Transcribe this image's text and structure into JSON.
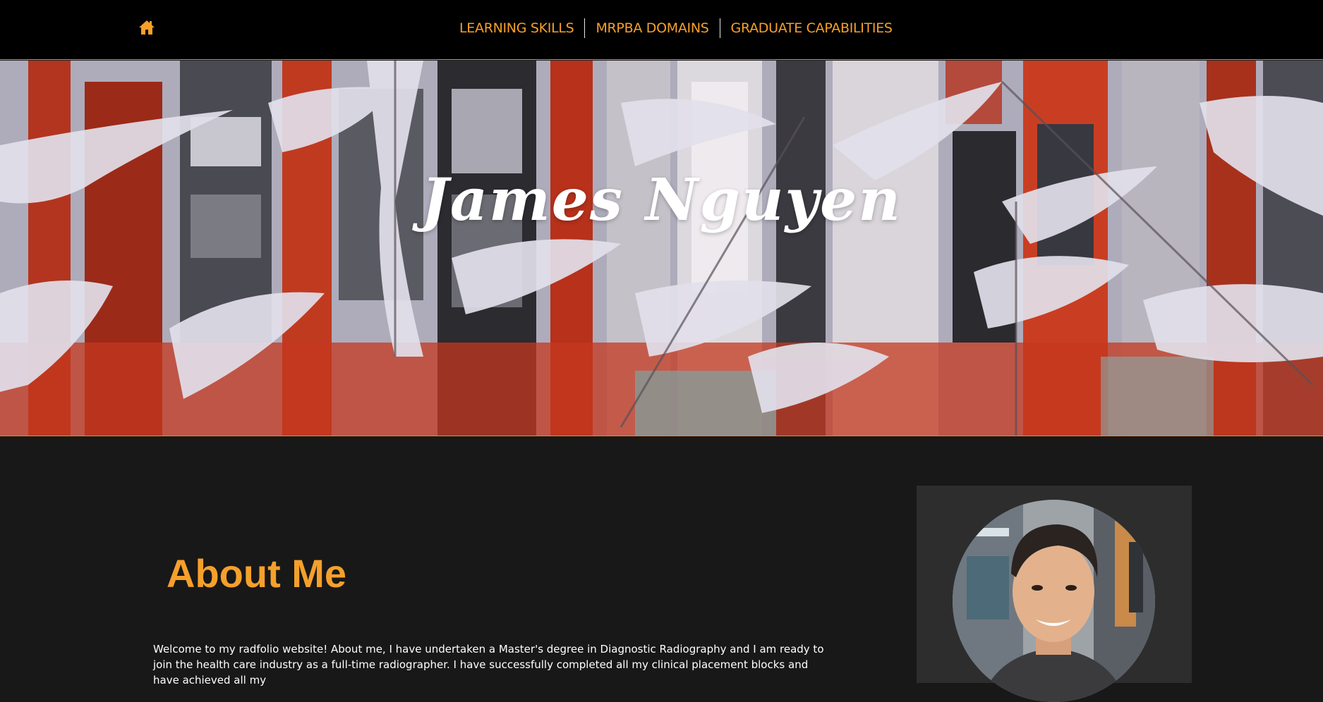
{
  "nav": {
    "home_icon": "home-icon",
    "items": [
      {
        "label": "LEARNING SKILLS"
      },
      {
        "label": "MRPBA DOMAINS"
      },
      {
        "label": "GRADUATE CAPABILITIES"
      }
    ]
  },
  "hero": {
    "title": "James Nguyen"
  },
  "about": {
    "heading": "About Me",
    "body": "Welcome to my radfolio website! About me, I have undertaken a Master's degree in Diagnostic Radiography and I am ready to join the health care industry as a full-time radiographer. I have successfully completed all my clinical placement blocks and have achieved all my"
  },
  "colors": {
    "accent": "#f5a02b",
    "topbar": "#000000",
    "page_bg": "#181818",
    "card_bg": "#2d2d2d"
  }
}
